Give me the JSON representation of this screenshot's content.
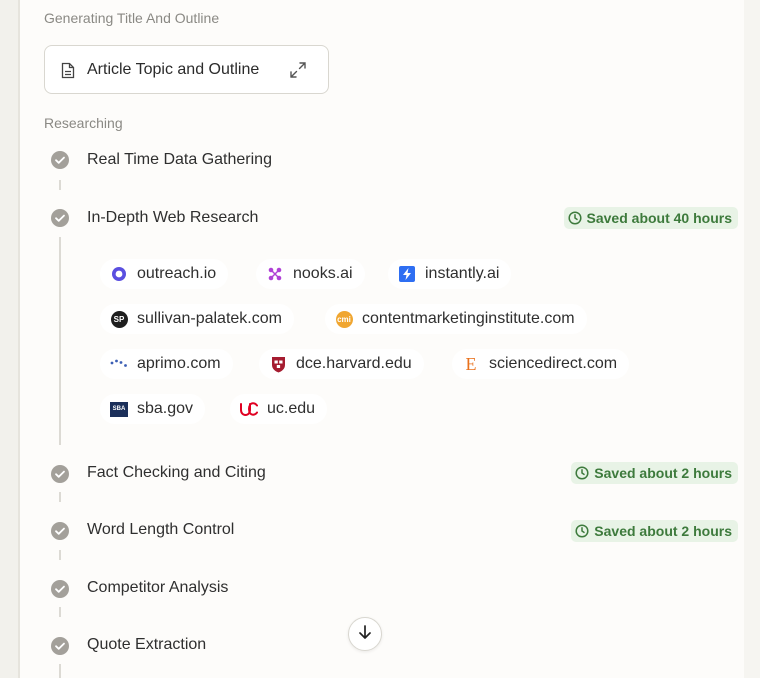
{
  "sections": {
    "outline_heading": "Generating Title And Outline",
    "research_heading": "Researching"
  },
  "outline_card": {
    "title": "Article Topic and Outline",
    "icon": "document-icon",
    "action_icon": "expand-icon"
  },
  "steps": [
    {
      "label": "Real Time Data Gathering",
      "status": "complete"
    },
    {
      "label": "In-Depth Web Research",
      "status": "complete",
      "saved": "Saved about 40 hours"
    },
    {
      "label": "Fact Checking and Citing",
      "status": "complete",
      "saved": "Saved about 2 hours"
    },
    {
      "label": "Word Length Control",
      "status": "complete",
      "saved": "Saved about 2 hours"
    },
    {
      "label": "Competitor Analysis",
      "status": "complete"
    },
    {
      "label": "Quote Extraction",
      "status": "complete"
    }
  ],
  "sources": [
    {
      "domain": "outreach.io",
      "icon": "outreach-favicon"
    },
    {
      "domain": "nooks.ai",
      "icon": "nooks-favicon"
    },
    {
      "domain": "instantly.ai",
      "icon": "instantly-favicon"
    },
    {
      "domain": "sullivan-palatek.com",
      "icon": "sullivan-palatek-favicon"
    },
    {
      "domain": "contentmarketinginstitute.com",
      "icon": "cmi-favicon"
    },
    {
      "domain": "aprimo.com",
      "icon": "aprimo-favicon"
    },
    {
      "domain": "dce.harvard.edu",
      "icon": "harvard-favicon"
    },
    {
      "domain": "sciencedirect.com",
      "icon": "sciencedirect-favicon"
    },
    {
      "domain": "sba.gov",
      "icon": "sba-favicon"
    },
    {
      "domain": "uc.edu",
      "icon": "uc-favicon"
    }
  ],
  "favicon_text": {
    "sp": "SP",
    "cmi": "cmi",
    "e": "E",
    "sba": "SBA"
  },
  "colors": {
    "check": "#a3a09a",
    "saved_bg": "#e8f3e6",
    "saved_text": "#3d7a3c"
  },
  "scroll_button_icon": "arrow-down-icon"
}
